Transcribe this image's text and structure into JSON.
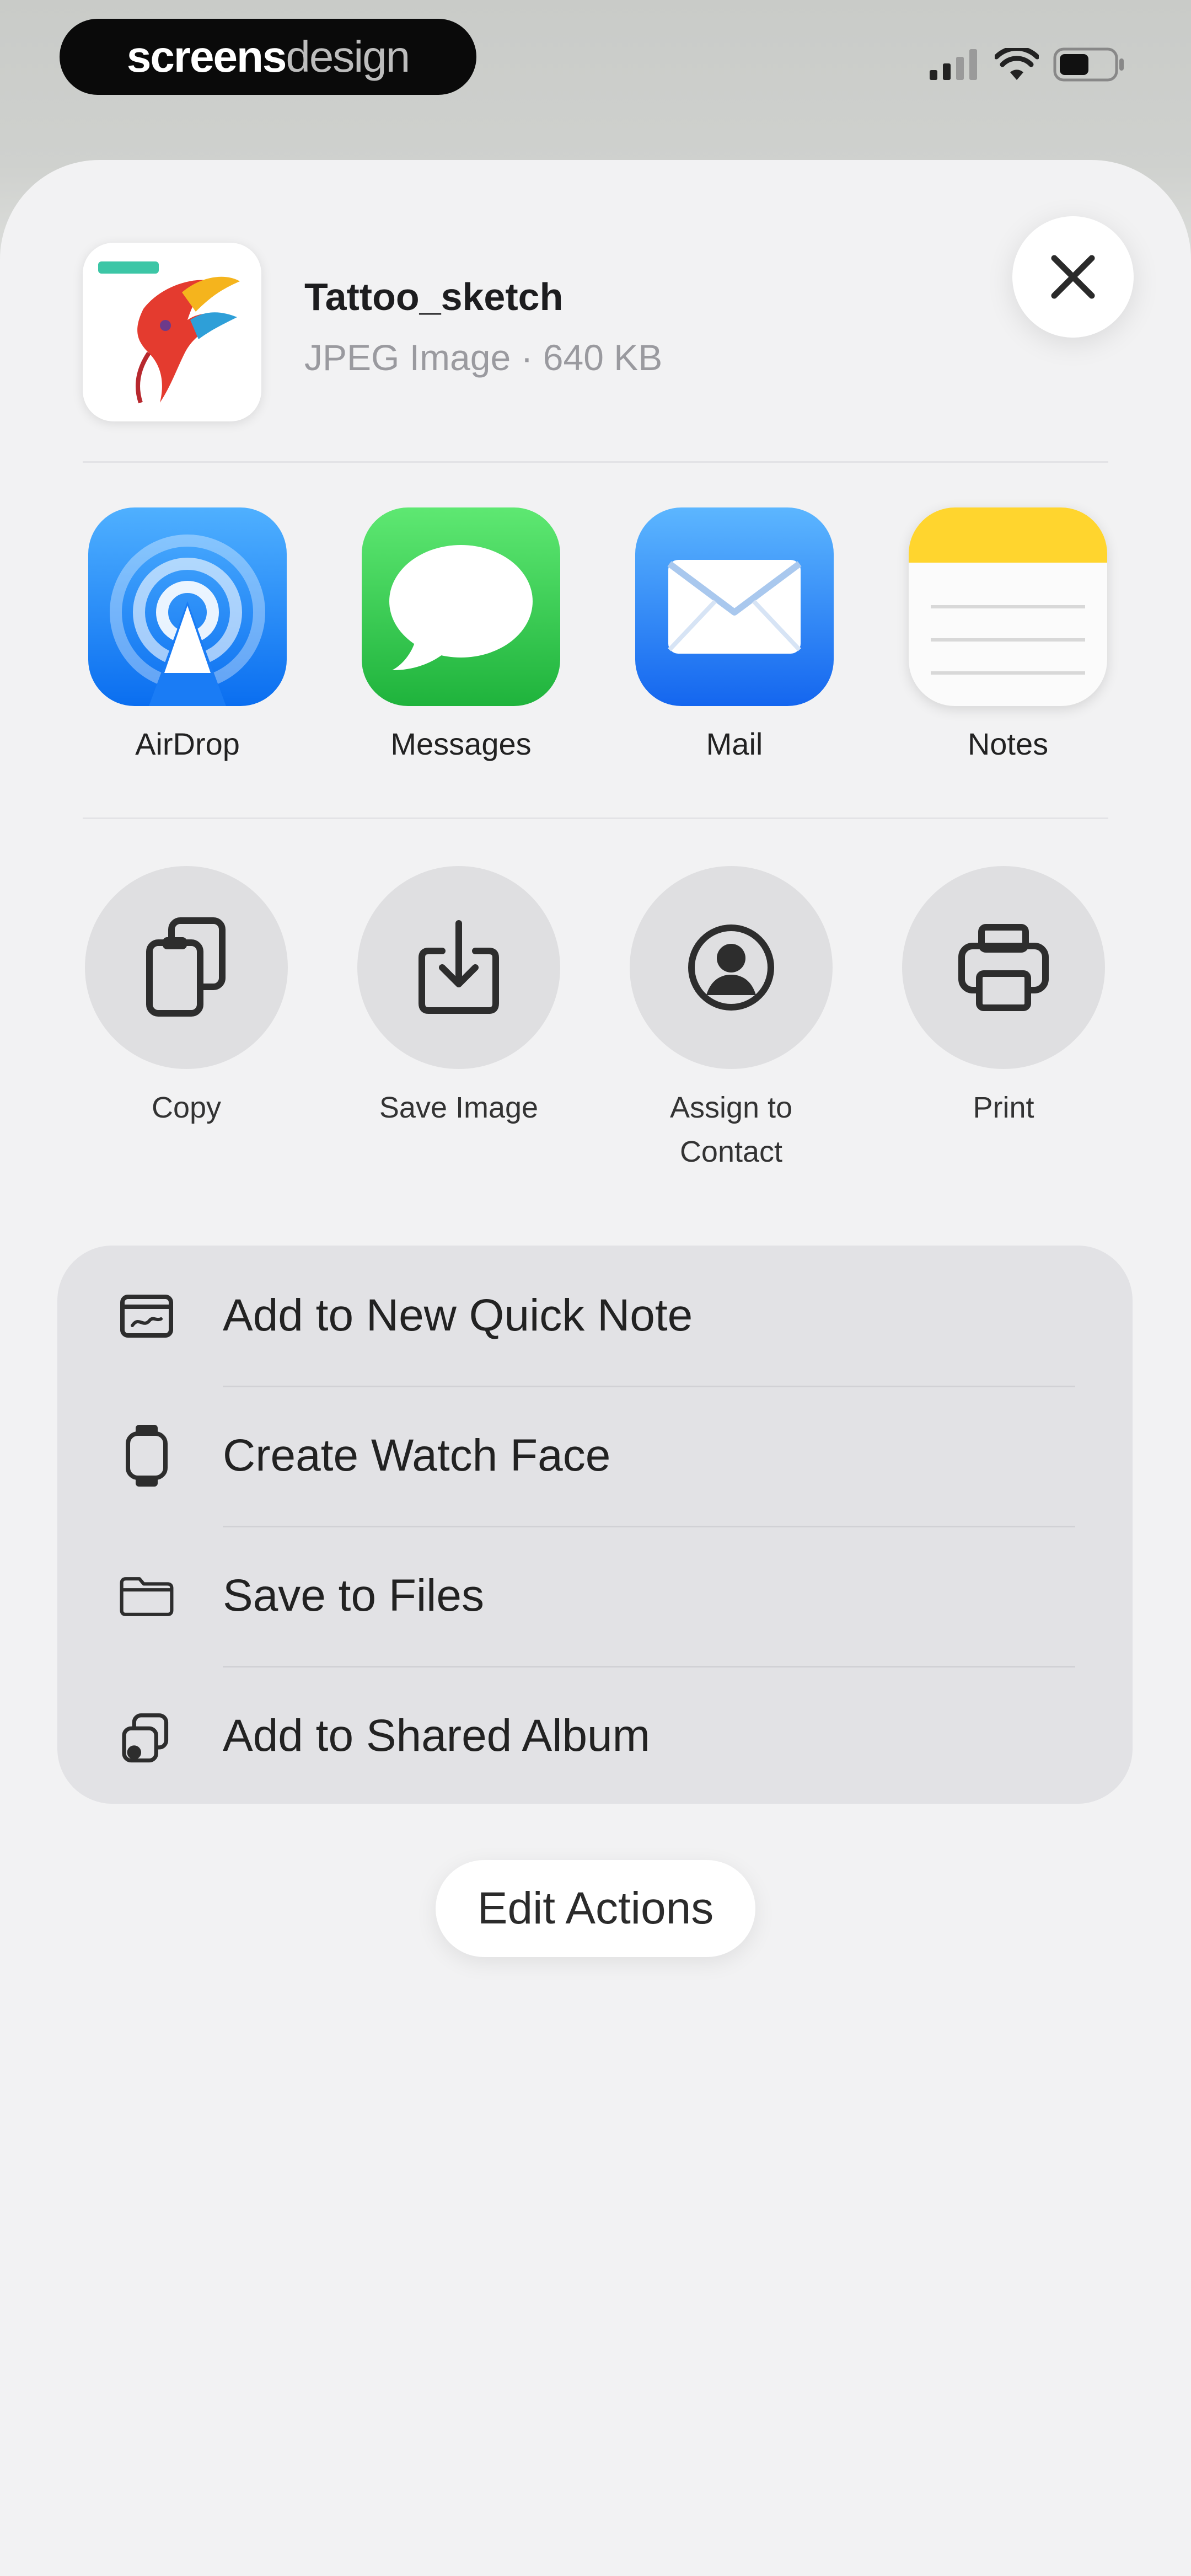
{
  "watermark": {
    "part1": "screens",
    "part2": "design"
  },
  "status_bar": {
    "icons": [
      "signal-icon",
      "wifi-icon",
      "battery-icon"
    ]
  },
  "share_sheet": {
    "file": {
      "name": "Tattoo_sketch",
      "details": "JPEG Image · 640 KB"
    },
    "close_icon": "close-icon",
    "apps": [
      {
        "label": "AirDrop",
        "icon": "airdrop-icon"
      },
      {
        "label": "Messages",
        "icon": "messages-icon"
      },
      {
        "label": "Mail",
        "icon": "mail-icon"
      },
      {
        "label": "Notes",
        "icon": "notes-icon"
      }
    ],
    "actions": [
      {
        "label": "Copy",
        "icon": "copy-icon"
      },
      {
        "label": "Save Image",
        "icon": "save-image-icon"
      },
      {
        "label": "Assign to\nContact",
        "icon": "contact-icon"
      },
      {
        "label": "Print",
        "icon": "print-icon"
      }
    ],
    "list": [
      {
        "label": "Add to New Quick Note",
        "icon": "quick-note-icon"
      },
      {
        "label": "Create Watch Face",
        "icon": "watch-icon"
      },
      {
        "label": "Save to Files",
        "icon": "folder-icon"
      },
      {
        "label": "Add to Shared Album",
        "icon": "shared-album-icon"
      }
    ],
    "edit_actions": "Edit Actions"
  },
  "colors": {
    "airdrop_blue": "#1a7cf5",
    "messages_green": "#34c759",
    "mail_blue": "#1f8df5",
    "notes_yellow": "#ffd52e",
    "sheet_bg": "#f2f2f3"
  }
}
